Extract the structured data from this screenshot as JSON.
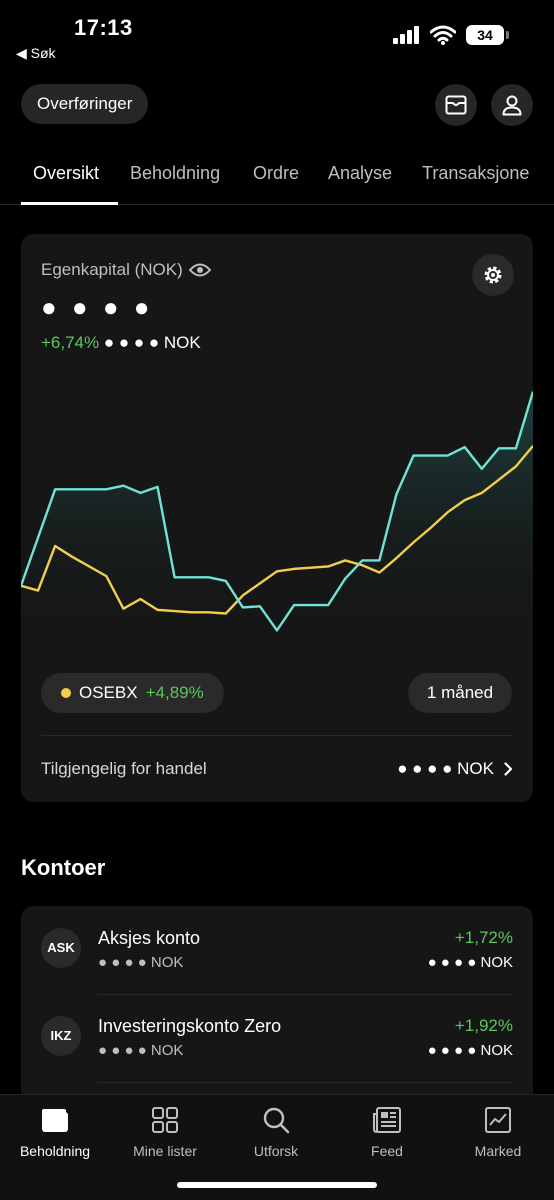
{
  "status": {
    "time": "17:13",
    "back_label": "◀ Søk",
    "battery": "34"
  },
  "header": {
    "transfers_label": "Overføringer",
    "icons": [
      "mail-icon",
      "user-icon"
    ]
  },
  "tabs": [
    {
      "label": "Oversikt",
      "active": true
    },
    {
      "label": "Beholdning",
      "active": false
    },
    {
      "label": "Ordre",
      "active": false
    },
    {
      "label": "Analyse",
      "active": false
    },
    {
      "label": "Transaksjone",
      "active": false
    }
  ],
  "equity": {
    "label": "Egenkapital (NOK)",
    "masked_value": "● ● ● ●",
    "change_pct": "+6,74%",
    "change_value": "● ● ● ● NOK"
  },
  "chart_data": {
    "type": "line",
    "series": [
      {
        "name": "portfolio",
        "color": "#6fe3d6",
        "values": [
          100,
          104,
          108,
          108,
          108,
          108,
          108.3,
          107.7,
          108.2,
          100.7,
          100.7,
          100.7,
          100.4,
          98.2,
          98.3,
          96.3,
          98.4,
          98.4,
          98.4,
          100.6,
          102.1,
          102.1,
          107.6,
          110.8,
          110.8,
          110.8,
          111.5,
          109.7,
          111.4,
          111.4,
          116.1
        ]
      },
      {
        "name": "OSEBX",
        "color": "#f2cf4b",
        "values": [
          100,
          99.6,
          103.3,
          102.4,
          101.6,
          100.8,
          98.1,
          98.9,
          98,
          97.9,
          97.8,
          97.8,
          97.7,
          99.2,
          100.2,
          101.2,
          101.4,
          101.5,
          101.6,
          102.1,
          101.7,
          101.1,
          102.3,
          103.6,
          104.8,
          106.1,
          107.1,
          107.7,
          108.8,
          109.9,
          111.6
        ]
      }
    ],
    "fill_under": "portfolio"
  },
  "benchmark": {
    "name": "OSEBX",
    "change_pct": "+4,89%"
  },
  "period_label": "1 måned",
  "available": {
    "label": "Tilgjengelig for handel",
    "value": "● ● ● ● NOK"
  },
  "accounts": {
    "title": "Kontoer",
    "items": [
      {
        "badge": "ASK",
        "name": "Aksjes konto",
        "value": "● ● ● ● NOK",
        "pct": "+1,72%",
        "total": "● ● ● ● NOK"
      },
      {
        "badge": "IKZ",
        "name": "Investeringskonto Zero",
        "value": "● ● ● ● NOK",
        "pct": "+1,92%",
        "total": "● ● ● ● NOK"
      }
    ]
  },
  "nav": [
    {
      "label": "Beholdning",
      "icon": "wallet-icon",
      "active": true
    },
    {
      "label": "Mine lister",
      "icon": "grid-icon",
      "active": false
    },
    {
      "label": "Utforsk",
      "icon": "search-icon",
      "active": false
    },
    {
      "label": "Feed",
      "icon": "newspaper-icon",
      "active": false
    },
    {
      "label": "Marked",
      "icon": "market-chart-icon",
      "active": false
    }
  ]
}
